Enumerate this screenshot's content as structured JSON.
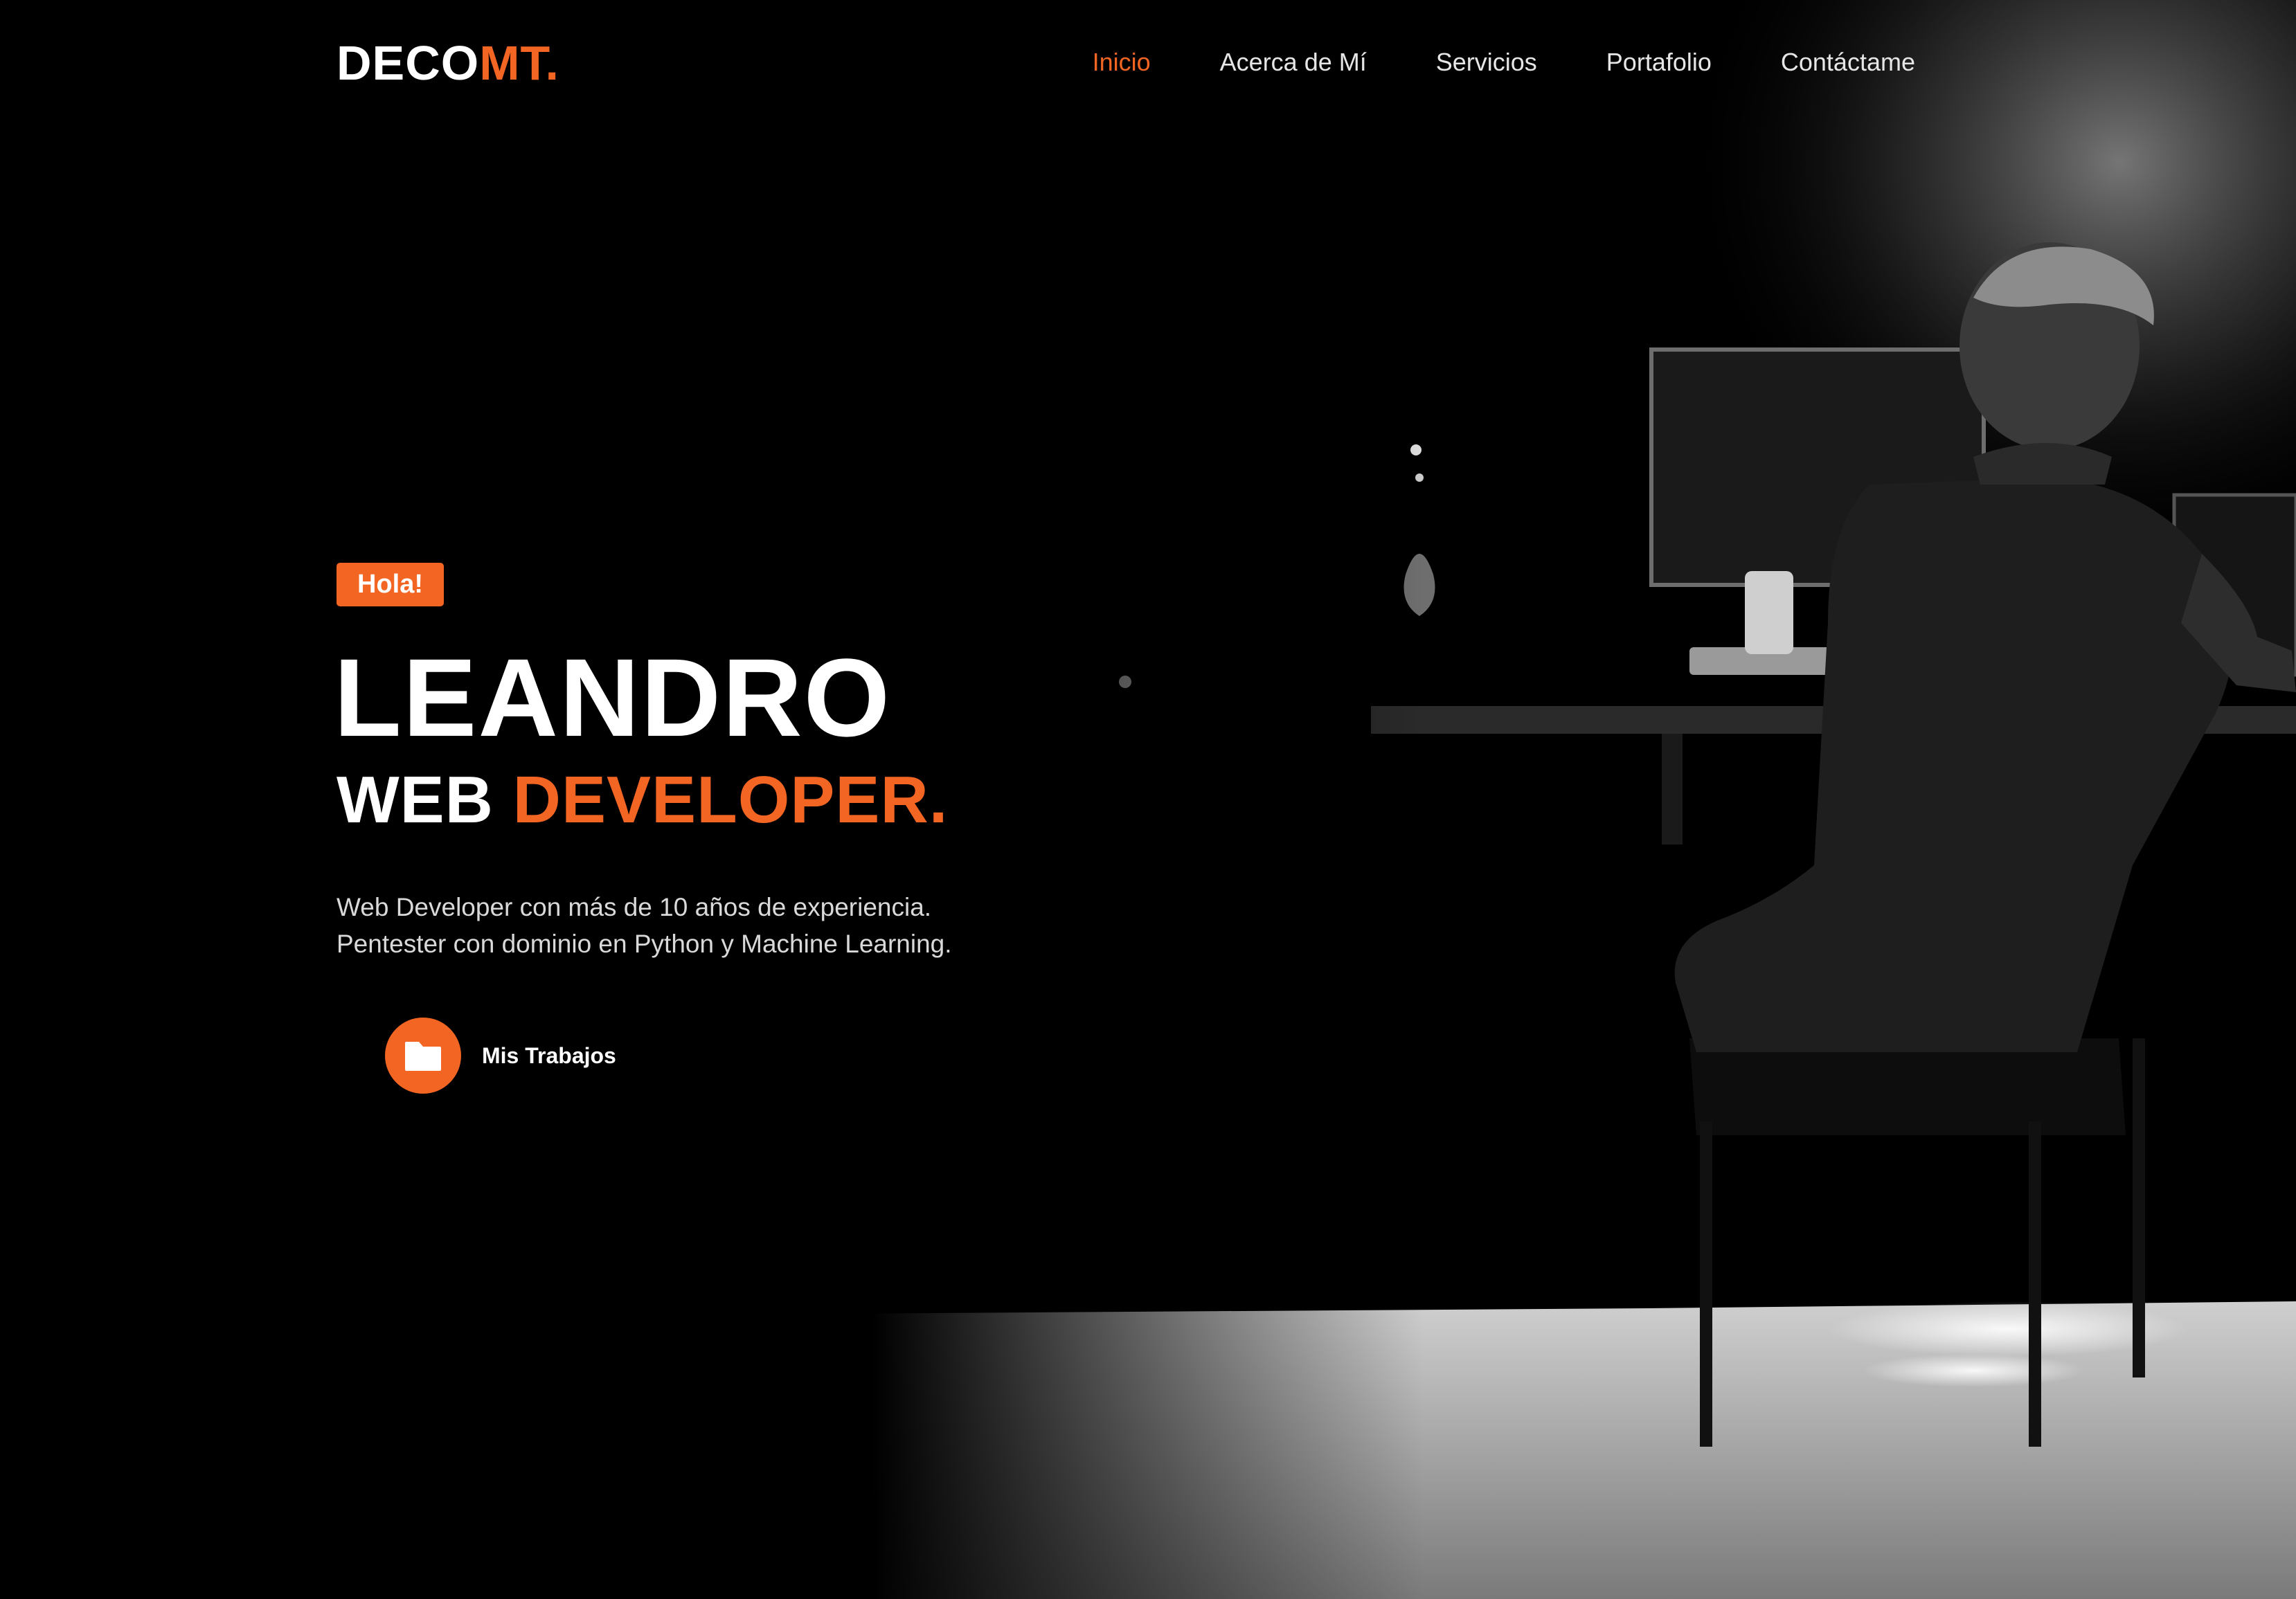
{
  "brand": {
    "logo_main": "DECO",
    "logo_accent": "MT."
  },
  "nav": {
    "items": [
      {
        "label": "Inicio",
        "active": true
      },
      {
        "label": "Acerca de Mí",
        "active": false
      },
      {
        "label": "Servicios",
        "active": false
      },
      {
        "label": "Portafolio",
        "active": false
      },
      {
        "label": "Contáctame",
        "active": false
      }
    ]
  },
  "hero": {
    "badge": "Hola!",
    "name": "LEANDRO",
    "role_main": "WEB",
    "role_accent": "DEVELOPER.",
    "description": [
      "Web Developer con más de 10 años de experiencia.",
      "Pentester con dominio en Python y Machine Learning."
    ],
    "cta": {
      "label": "Mis Trabajos",
      "icon": "folder-icon"
    }
  },
  "colors": {
    "accent": "#f26522",
    "background": "#000000",
    "text": "#ffffff"
  }
}
